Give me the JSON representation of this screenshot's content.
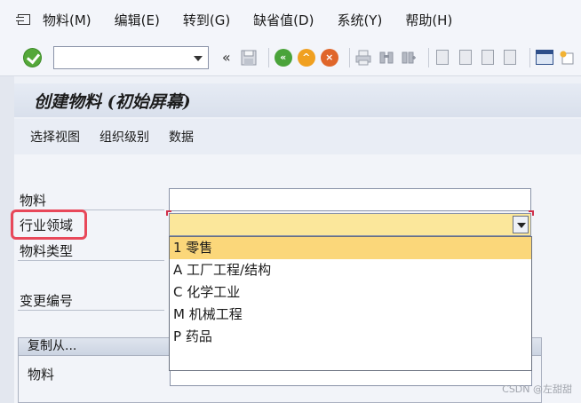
{
  "menu": {
    "items": [
      "物料(M)",
      "编辑(E)",
      "转到(G)",
      "缺省值(D)",
      "系统(Y)",
      "帮助(H)"
    ]
  },
  "toolbar": {
    "command_value": "",
    "icons": [
      "enter-icon",
      "save-icon",
      "back-icon",
      "exit-icon",
      "cancel-icon",
      "print-icon",
      "find-icon",
      "find-next-icon",
      "first-page-icon",
      "previous-page-icon",
      "next-page-icon",
      "last-page-icon",
      "layout-icon"
    ]
  },
  "title": "创建物料 (初始屏幕)",
  "app_toolbar": {
    "buttons": [
      "选择视图",
      "组织级别",
      "数据"
    ]
  },
  "form": {
    "material_label": "物料",
    "material_value": "",
    "industry_label": "行业领域",
    "industry_value": "",
    "material_type_label": "物料类型",
    "change_number_label": "变更编号"
  },
  "dropdown": {
    "options": [
      "1 零售",
      "A 工厂工程/结构",
      "C 化学工业",
      "M 机械工程",
      "P 药品"
    ],
    "selected_index": 0
  },
  "copy_from": {
    "title": "复制从...",
    "material_label": "物料"
  },
  "watermark": "CSDN @左甜甜",
  "colors": {
    "highlight_border": "#e8485a",
    "combo_bg": "#fbe79b",
    "selected_option_bg": "#fbd77a"
  }
}
